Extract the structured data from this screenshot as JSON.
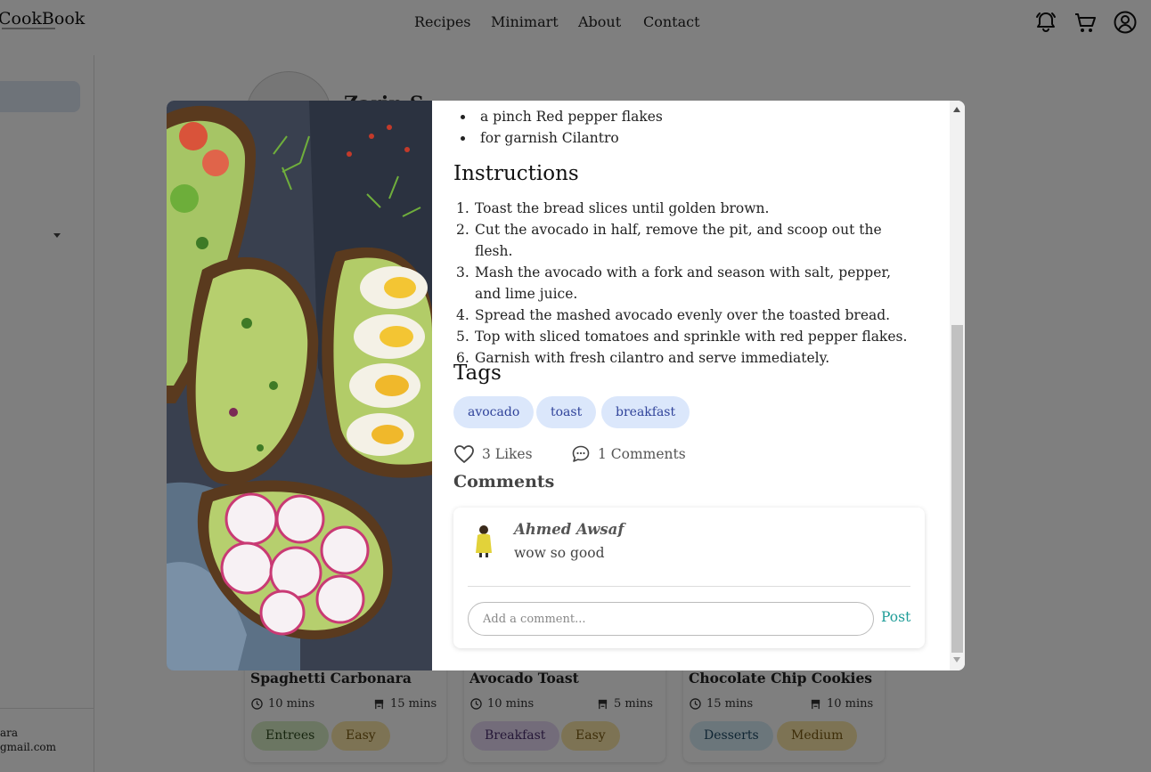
{
  "header": {
    "logo": "CookBook",
    "nav": [
      "Recipes",
      "Minimart",
      "About",
      "Contact"
    ]
  },
  "sidebar": {
    "user_name_partial": "ara",
    "user_email_partial": "gmail.com"
  },
  "profile": {
    "name_partial": "Zarin S"
  },
  "cards": [
    {
      "title": "Spaghetti Carbonara",
      "prep": "10 mins",
      "cook": "15 mins",
      "category": "Entrees",
      "difficulty": "Easy"
    },
    {
      "title": "Avocado Toast",
      "prep": "10 mins",
      "cook": "5 mins",
      "category": "Breakfast",
      "difficulty": "Easy"
    },
    {
      "title": "Chocolate Chip Cookies",
      "prep": "15 mins",
      "cook": "10 mins",
      "category": "Desserts",
      "difficulty": "Medium"
    }
  ],
  "modal": {
    "ingredients_visible": [
      "a pinch Red pepper flakes",
      "for garnish Cilantro"
    ],
    "instructions_heading": "Instructions",
    "instructions": [
      "Toast the bread slices until golden brown.",
      "Cut the avocado in half, remove the pit, and scoop out the flesh.",
      "Mash the avocado with a fork and season with salt, pepper, and lime juice.",
      "Spread the mashed avocado evenly over the toasted bread.",
      "Top with sliced tomatoes and sprinkle with red pepper flakes.",
      "Garnish with fresh cilantro and serve immediately."
    ],
    "tags_heading": "Tags",
    "tags": [
      "avocado",
      "toast",
      "breakfast"
    ],
    "likes": "3 Likes",
    "comments_count": "1 Comments",
    "comments_heading": "Comments",
    "comments": [
      {
        "author": "Ahmed Awsaf",
        "text": "wow so good"
      }
    ],
    "comment_input": {
      "placeholder": "Add a comment...",
      "value": ""
    },
    "post_label": "Post"
  },
  "colors": {
    "overlay": "rgba(0,0,0,0.5)",
    "tag_bg": "#dbe7fb",
    "tag_text": "#30439a",
    "post_accent": "#1f9d98",
    "entrees_pill": "#d6ecc5",
    "easy_pill": "#fbe6a8",
    "breakfast_pill": "#e7d9f5",
    "desserts_pill": "#d7ecf6",
    "medium_pill": "#fbe6a8"
  },
  "icons": [
    "bell-icon",
    "cart-icon",
    "user-circle-icon",
    "clock-icon",
    "cook-icon",
    "heart-icon",
    "comment-icon"
  ]
}
